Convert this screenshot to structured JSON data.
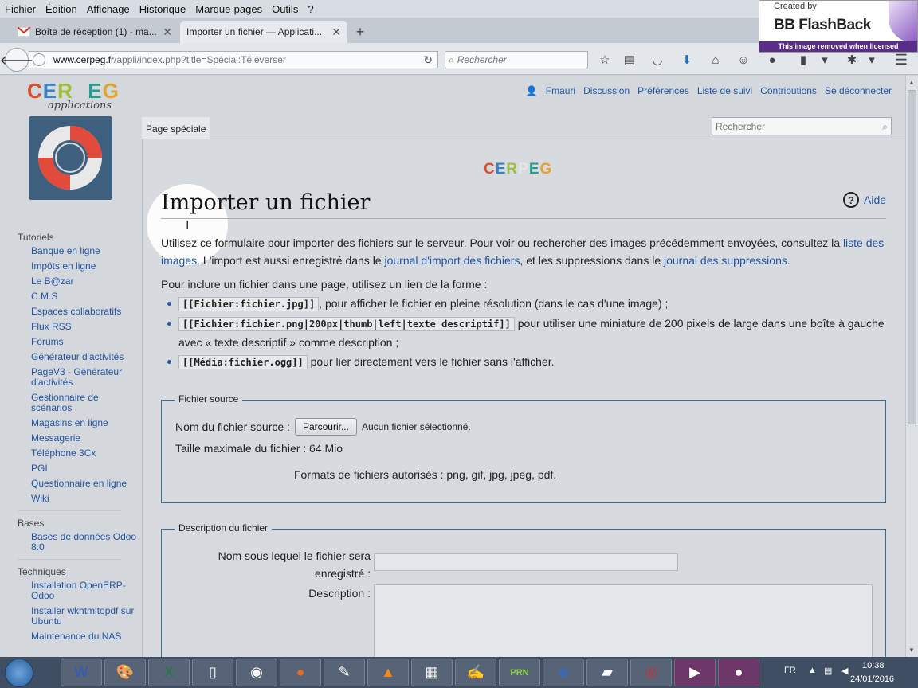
{
  "browser": {
    "menu": [
      "Fichier",
      "Édition",
      "Affichage",
      "Historique",
      "Marque-pages",
      "Outils",
      "?"
    ],
    "tabs": [
      {
        "title": "Boîte de réception (1) - ma...",
        "icon": "gmail-icon",
        "active": false
      },
      {
        "title": "Importer un fichier — Applicati...",
        "icon": "",
        "active": true
      }
    ],
    "url_host": "www.cerpeg.fr",
    "url_path": "/appli/index.php?title=Spécial:Téléverser",
    "search_placeholder": "Rechercher"
  },
  "watermark": {
    "created_by": "Created by",
    "product": "BB FlashBack",
    "strip": "This image removed when licensed"
  },
  "site": {
    "logo": "CERPEG",
    "logo_sub": "applications",
    "personal": {
      "user": "Fmauri",
      "discussion": "Discussion",
      "preferences": "Préférences",
      "watchlist": "Liste de suivi",
      "contributions": "Contributions",
      "logout": "Se déconnecter"
    },
    "special_tab": "Page spéciale",
    "search_placeholder": "Rechercher"
  },
  "sidebar": {
    "sections": [
      {
        "title": "Tutoriels",
        "items": [
          "Banque en ligne",
          "Impôts en ligne",
          "Le B@zar",
          "C.M.S",
          "Espaces collaboratifs",
          "Flux RSS",
          "Forums",
          "Générateur d'activités",
          "PageV3 - Générateur d'activités",
          "Gestionnaire de scénarios",
          "Magasins en ligne",
          "Messagerie",
          "Téléphone 3Cx",
          "PGI",
          "Questionnaire en ligne",
          "Wiki"
        ]
      },
      {
        "title": "Bases",
        "items": [
          "Bases de données Odoo 8.0"
        ]
      },
      {
        "title": "Techniques",
        "items": [
          "Installation OpenERP-Odoo",
          "Installer wkhtmltopdf sur Ubuntu",
          "Maintenance du NAS"
        ]
      }
    ]
  },
  "content": {
    "center_logo": "CERPEG",
    "title": "Importer un fichier",
    "help": "Aide",
    "intro_1": "Utilisez ce formulaire pour importer des fichiers sur le serveur. Pour voir ou rechercher des images précédemment envoyées, consultez la ",
    "intro_link1": "liste des images",
    "intro_2": ". L'import est aussi enregistré dans le ",
    "intro_link2": "journal d'import des fichiers",
    "intro_3": ", et les suppressions dans le ",
    "intro_link3": "journal des suppressions",
    "intro_4": ".",
    "inline_intro": "Pour inclure un fichier dans une page, utilisez un lien de la forme :",
    "syntax": [
      {
        "code": "[[Fichier:fichier.jpg]]",
        "text": ", pour afficher le fichier en pleine résolution (dans le cas d'une image) ;"
      },
      {
        "code": "[[Fichier:fichier.png|200px|thumb|left|texte descriptif]]",
        "text": " pour utiliser une miniature de 200 pixels de large dans une boîte à gauche avec « texte descriptif » comme description ;"
      },
      {
        "code": "[[Média:fichier.ogg]]",
        "text": " pour lier directement vers le fichier sans l'afficher."
      }
    ],
    "source": {
      "legend": "Fichier source",
      "file_label": "Nom du fichier source :",
      "browse": "Parcourir...",
      "no_file": "Aucun fichier sélectionné.",
      "max_size": "Taille maximale du fichier : 64 Mio",
      "formats": "Formats de fichiers autorisés : png, gif, jpg, jpeg, pdf."
    },
    "description": {
      "legend": "Description du fichier",
      "dest_label_1": "Nom sous lequel le fichier sera",
      "dest_label_2": "enregistré :",
      "desc_label": "Description :"
    }
  },
  "taskbar": {
    "lang": "FR",
    "time": "10:38",
    "date": "24/01/2016"
  }
}
